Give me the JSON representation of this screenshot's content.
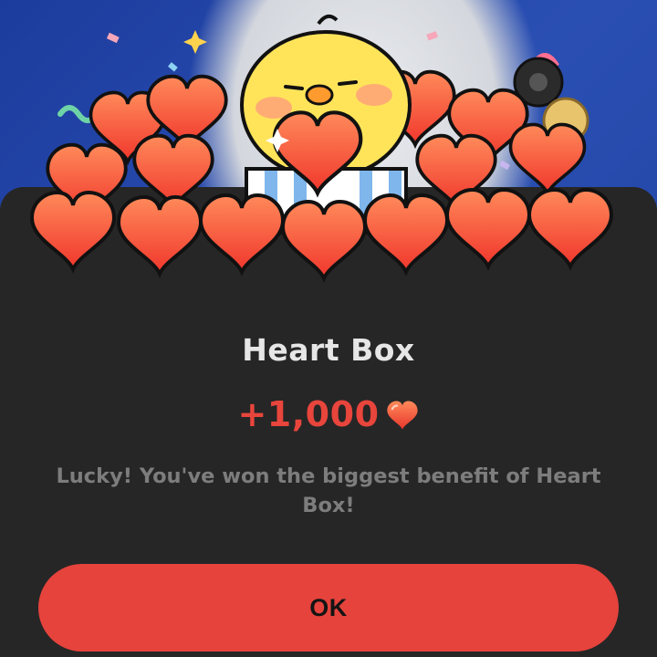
{
  "dialog": {
    "title": "Heart Box",
    "reward_amount": "+1,000",
    "reward_icon": "heart-icon",
    "message": "Lucky! You've won the biggest benefit of Heart Box!",
    "ok_label": "OK"
  },
  "colors": {
    "accent": "#e5433c",
    "reward_text": "#e8453c",
    "sheet_background": "#262626",
    "title_text": "#e6e6e6",
    "message_text": "#7d7d7d"
  }
}
